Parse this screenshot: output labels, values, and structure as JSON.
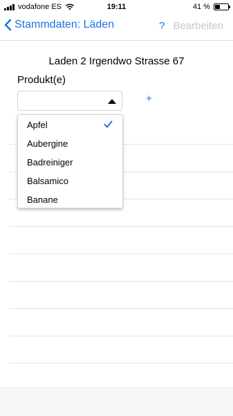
{
  "status": {
    "carrier": "vodafone ES",
    "time": "19:11",
    "battery_percent": "41 %",
    "battery_level": 0.41
  },
  "nav": {
    "back_label": "Stammdaten: Läden",
    "help_label": "?",
    "edit_label": "Bearbeiten"
  },
  "shop": {
    "title": "Laden 2 Irgendwo Strasse 67"
  },
  "form": {
    "product_label": "Produkt(e)",
    "selected_value": "",
    "add_label": "+"
  },
  "dropdown": {
    "options": [
      "Apfel",
      "Aubergine",
      "Badreiniger",
      "Balsamico",
      "Banane"
    ],
    "selected_index": 0
  },
  "colors": {
    "accent": "#1a73e8",
    "disabled": "#c6c6c8"
  },
  "icons": [
    "back-chevron-icon",
    "wifi-icon",
    "battery-icon",
    "checkmark-icon",
    "dropdown-arrow-icon"
  ]
}
